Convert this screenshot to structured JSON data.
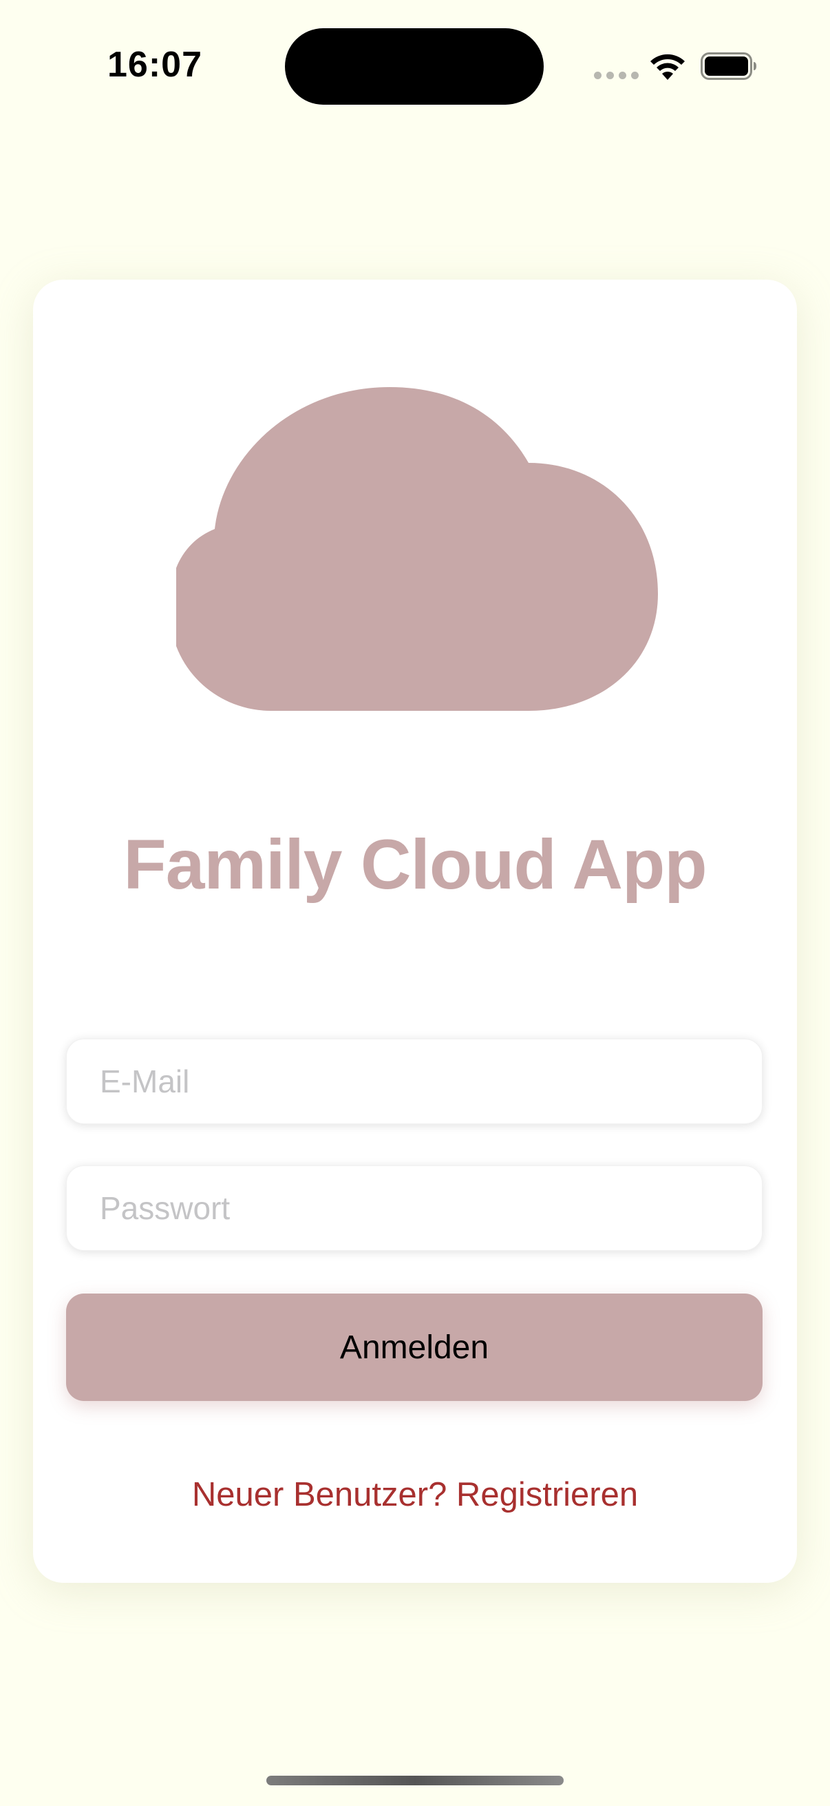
{
  "status_bar": {
    "time": "16:07",
    "icons": [
      "signal-dots-icon",
      "wifi-icon",
      "battery-icon"
    ]
  },
  "login_card": {
    "logo_icon": "cloud-icon",
    "title": "Family Cloud App",
    "email_placeholder": "E-Mail",
    "email_value": "",
    "password_placeholder": "Passwort",
    "password_value": "",
    "login_label": "Anmelden",
    "register_link": "Neuer Benutzer? Registrieren"
  },
  "colors": {
    "background": "#fefff0",
    "card": "#ffffff",
    "accent": "#c7a8a8",
    "link": "#a8302f"
  }
}
